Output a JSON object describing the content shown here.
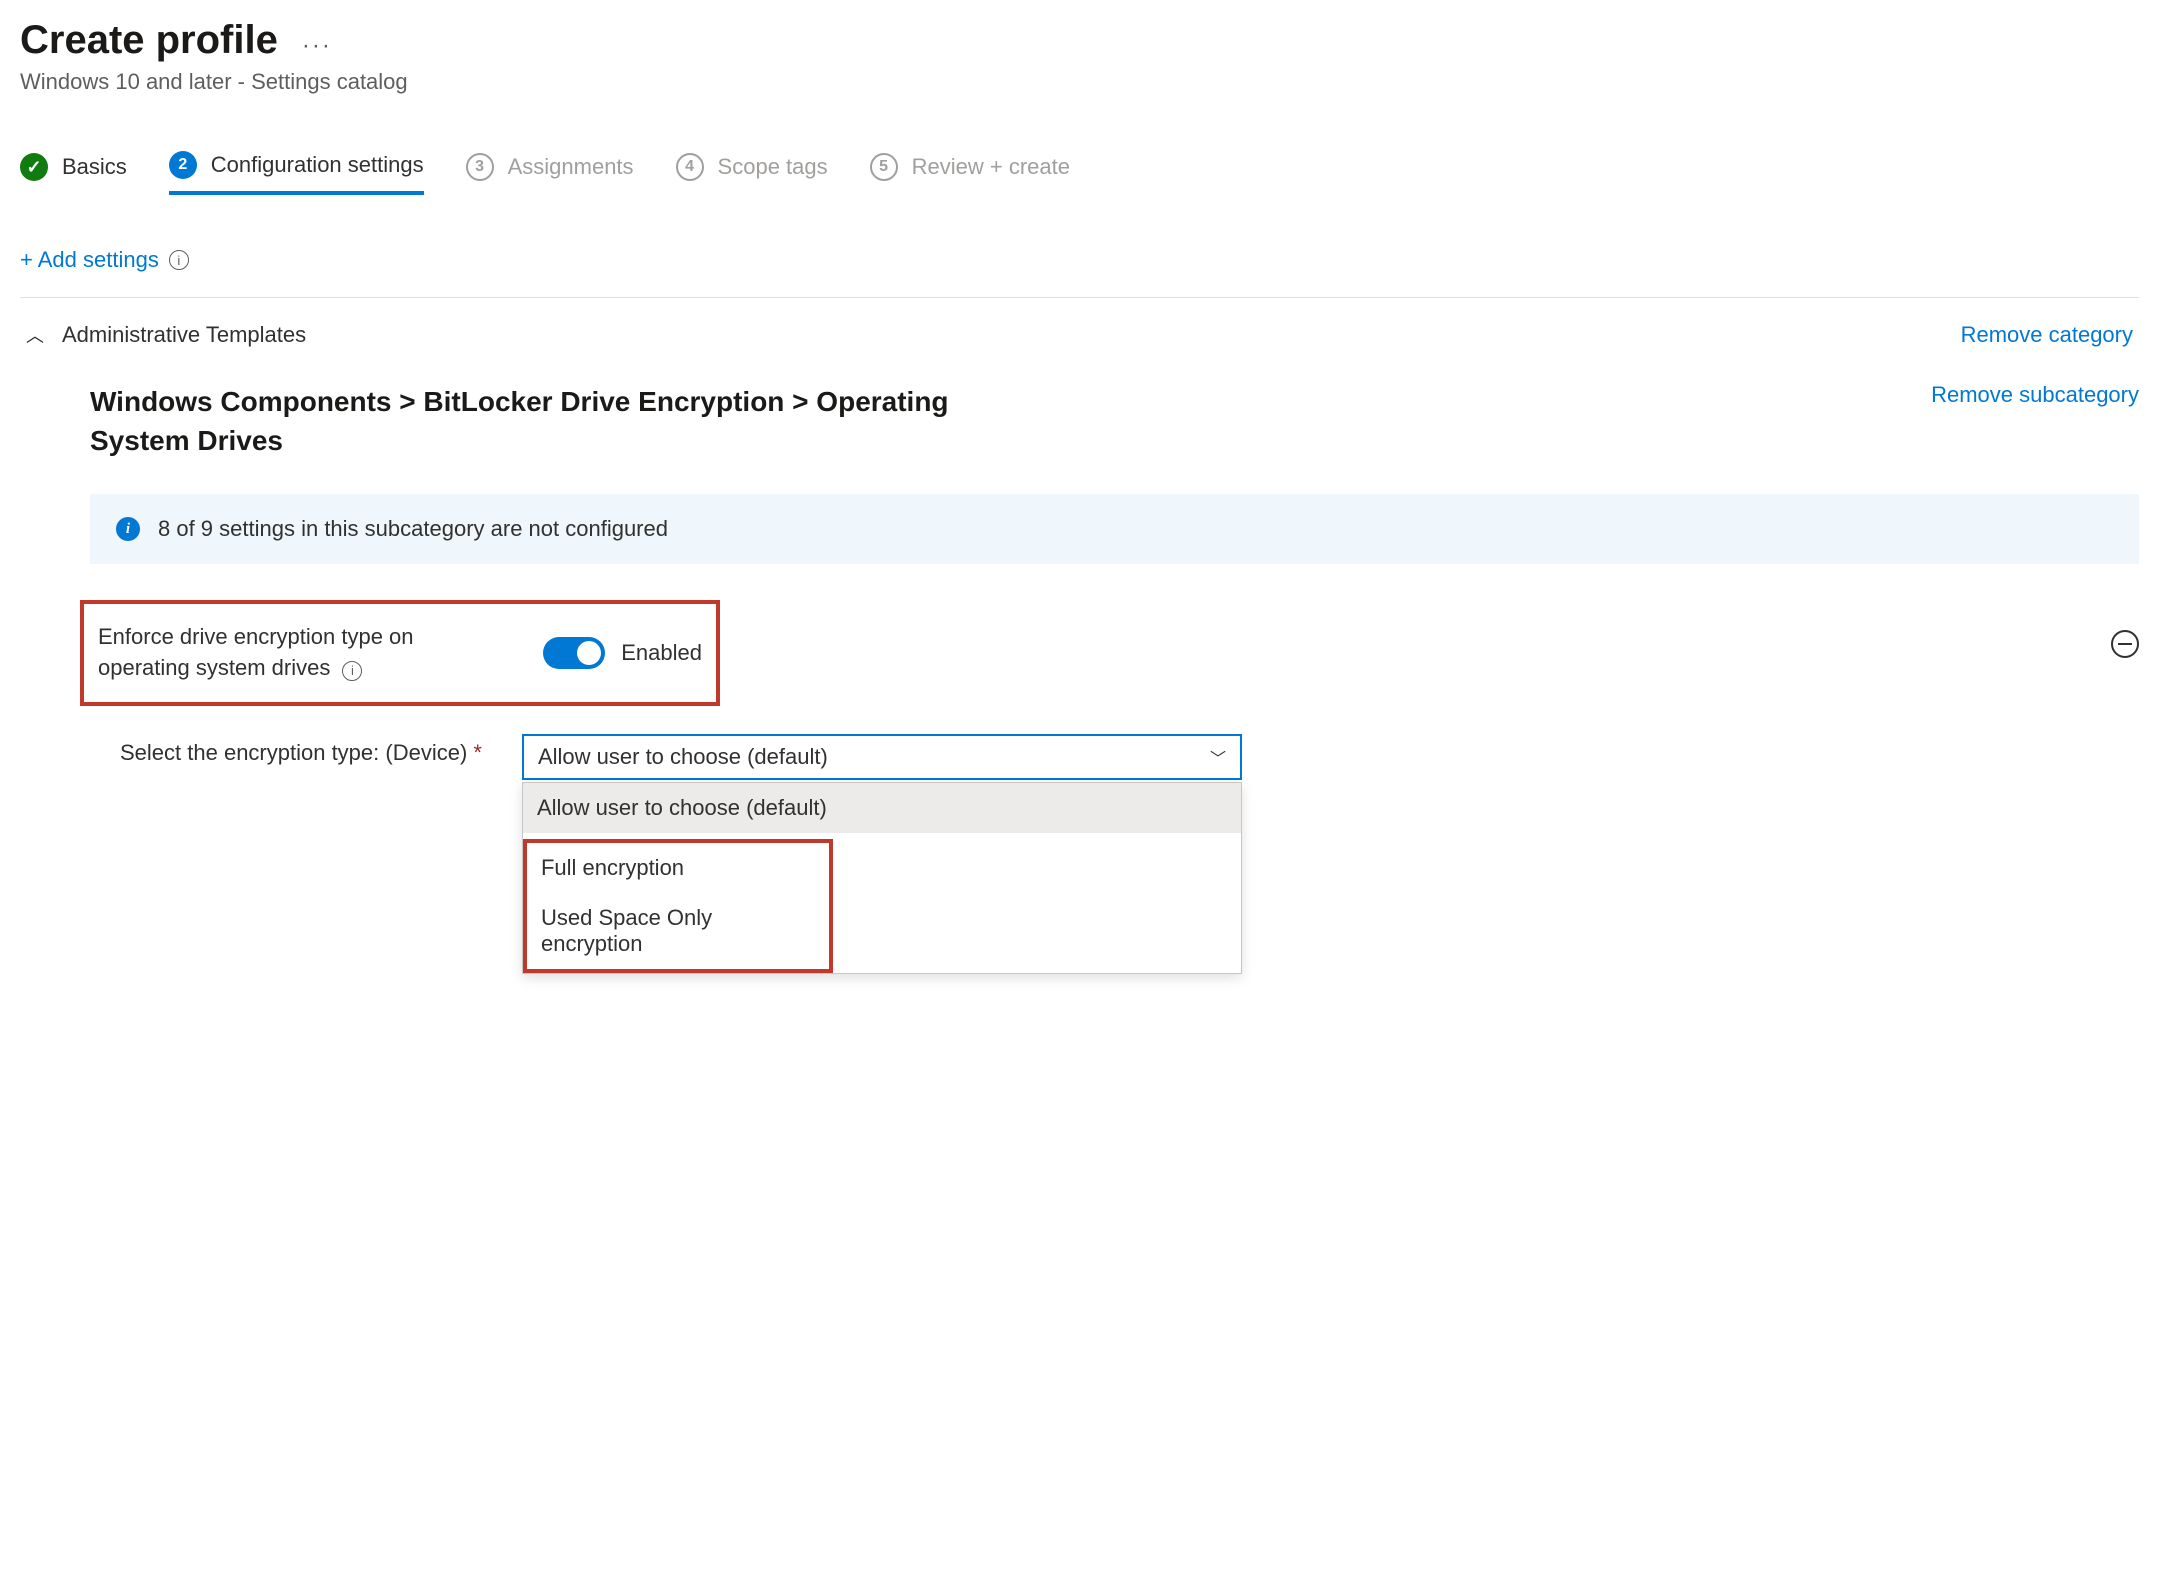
{
  "header": {
    "title": "Create profile",
    "subtitle": "Windows 10 and later - Settings catalog"
  },
  "stepper": {
    "steps": [
      {
        "num": "",
        "label": "Basics",
        "state": "done"
      },
      {
        "num": "2",
        "label": "Configuration settings",
        "state": "active"
      },
      {
        "num": "3",
        "label": "Assignments",
        "state": "pending"
      },
      {
        "num": "4",
        "label": "Scope tags",
        "state": "pending"
      },
      {
        "num": "5",
        "label": "Review + create",
        "state": "pending"
      }
    ]
  },
  "actions": {
    "add_settings": "+ Add settings",
    "remove_category": "Remove category",
    "remove_subcategory": "Remove subcategory"
  },
  "category": {
    "title": "Administrative Templates"
  },
  "subcategory": {
    "title": "Windows Components > BitLocker Drive Encryption > Operating System Drives"
  },
  "info_bar": {
    "text": "8 of 9 settings in this subcategory are not configured"
  },
  "setting": {
    "label": "Enforce drive encryption type on operating system drives",
    "toggle_state": "Enabled"
  },
  "sub_setting": {
    "label": "Select the encryption type: (Device)",
    "required": "*",
    "selected": "Allow user to choose (default)",
    "options": [
      "Allow user to choose (default)",
      "Full encryption",
      "Used Space Only encryption"
    ]
  }
}
